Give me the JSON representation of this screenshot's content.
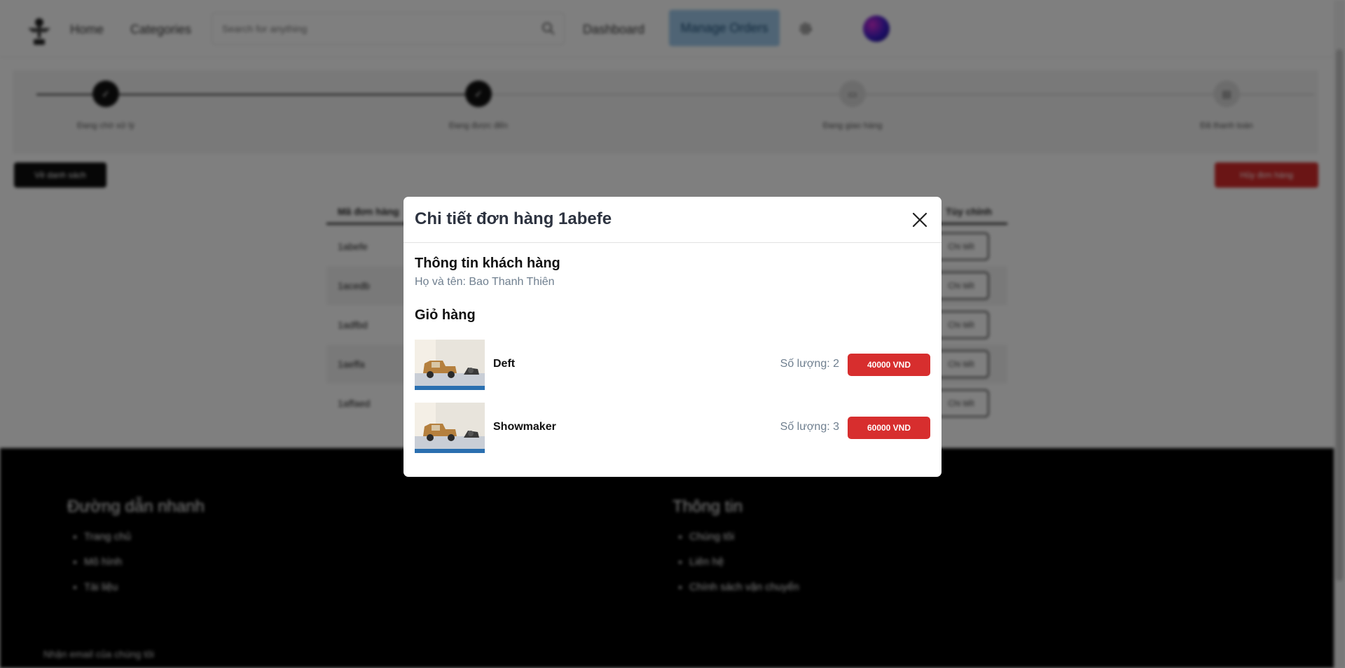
{
  "nav": {
    "home": "Home",
    "categories": "Categories",
    "search_placeholder": "Search for anything",
    "dashboard": "Dashboard",
    "manage_orders": "Manage Orders"
  },
  "stepper": {
    "steps": [
      {
        "label": "Đang chờ xử lý",
        "state": "done"
      },
      {
        "label": "Đang được đến",
        "state": "done"
      },
      {
        "label": "Đang giao hàng",
        "state": "pending"
      },
      {
        "label": "Đã thanh toán",
        "state": "pending"
      }
    ]
  },
  "actions": {
    "back_label": "Về danh sách",
    "cancel_label": "Hủy đơn hàng"
  },
  "orders_table": {
    "headers": [
      "Mã đơn hàng",
      "Tùy chỉnh"
    ],
    "rows": [
      {
        "id": "1abefe",
        "action": "Chi tiết"
      },
      {
        "id": "1acedb",
        "action": "Chi tiết"
      },
      {
        "id": "1adfbd",
        "action": "Chi tiết"
      },
      {
        "id": "1aeffa",
        "action": "Chi tiết"
      },
      {
        "id": "1affaed",
        "action": "Chi tiết"
      }
    ]
  },
  "footer": {
    "quick_links_title": "Đường dẫn nhanh",
    "quick_links": [
      "Trang chủ",
      "Mô hình",
      "Tài liệu"
    ],
    "info_title": "Thông tin",
    "info_links": [
      "Chúng tôi",
      "Liên hệ",
      "Chính sách vận chuyển"
    ],
    "newsletter": "Nhận email của chúng tôi"
  },
  "modal": {
    "title": "Chi tiết đơn hàng 1abefe",
    "customer_section": "Thông tin khách hàng",
    "customer_name": "Họ và tên: Bao Thanh Thiên",
    "cart_section": "Giỏ hàng",
    "cart_items": [
      {
        "name": "Deft",
        "quantity": "Số lượng: 2",
        "price": "40000 VND"
      },
      {
        "name": "Showmaker",
        "quantity": "Số lượng: 3",
        "price": "60000 VND"
      }
    ]
  },
  "colors": {
    "overlay": "#00000080",
    "price_button": "#d72e2e",
    "manage_orders_bg": "#9ec9ea",
    "muted_text": "#6f7f8f"
  }
}
